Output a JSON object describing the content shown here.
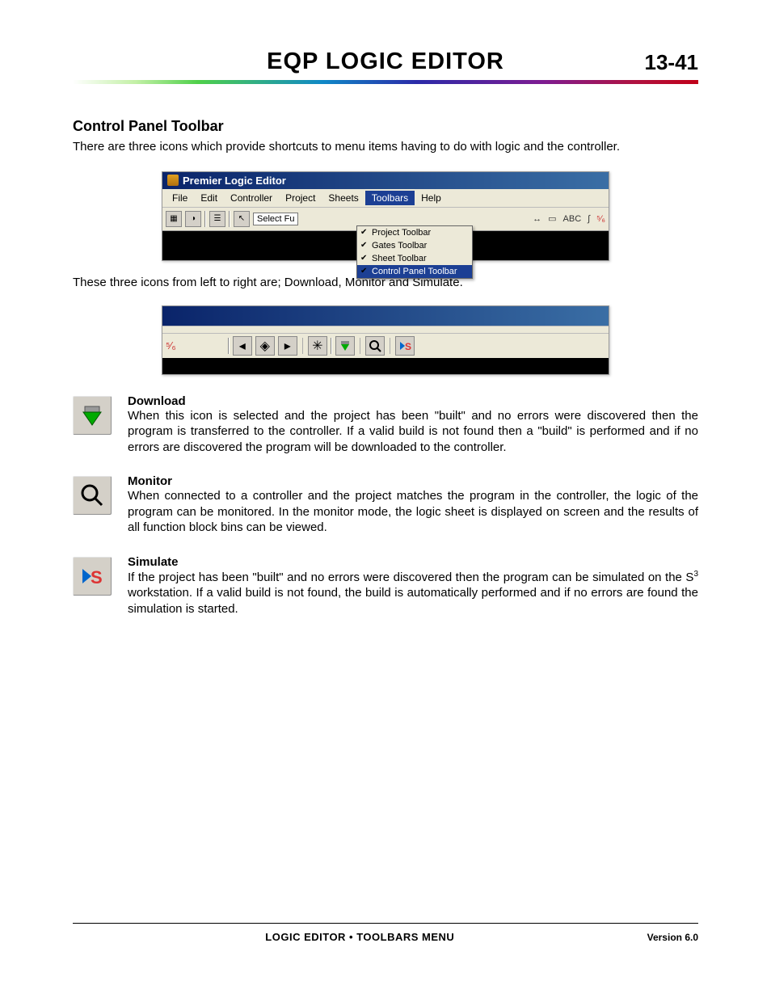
{
  "header": {
    "title": "EQP LOGIC EDITOR",
    "page_number": "13-41"
  },
  "section": {
    "title": "Control Panel Toolbar"
  },
  "intro_text": "There are three icons which provide shortcuts to menu items having to do with logic and the controller.",
  "figure1": {
    "window_title": "Premier Logic Editor",
    "menu": [
      "File",
      "Edit",
      "Controller",
      "Project",
      "Sheets",
      "Toolbars",
      "Help"
    ],
    "menu_active_index": 5,
    "select_label": "Select Fu",
    "dropdown_items": [
      {
        "label": "Project Toolbar",
        "checked": true,
        "highlight": false
      },
      {
        "label": "Gates Toolbar",
        "checked": true,
        "highlight": false
      },
      {
        "label": "Sheet Toolbar",
        "checked": true,
        "highlight": false
      },
      {
        "label": "Control Panel Toolbar",
        "checked": true,
        "highlight": true
      }
    ],
    "right_text": "ABC"
  },
  "mid_text": "These three icons from left to right are; Download, Monitor and Simulate.",
  "definitions": [
    {
      "title": "Download",
      "text": "When this icon is selected and the project has been \"built\" and no errors were discovered then the program is transferred to the controller.  If a valid build is not found then a \"build\" is performed and if no errors are discovered the program will be downloaded to the controller."
    },
    {
      "title": "Monitor",
      "text": "When connected to a controller and the project matches the program in the controller, the logic of the program can be monitored.  In the monitor mode, the logic sheet is displayed on screen and the results of all function block bins can be viewed."
    },
    {
      "title": "Simulate",
      "text_pre": "If the project has been \"built\" and no errors were discovered then the program can be simulated on the S",
      "text_sup": "3",
      "text_post": " workstation.  If a valid build is not found, the build is automatically performed and if no errors are found the simulation is started."
    }
  ],
  "footer": {
    "center": "LOGIC EDITOR • TOOLBARS MENU",
    "right": "Version 6.0"
  }
}
